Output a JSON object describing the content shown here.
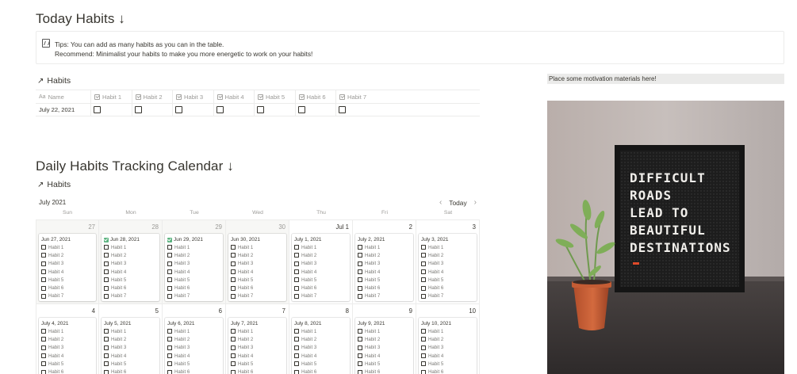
{
  "today": {
    "title": "Today Habits ↓",
    "callout": {
      "line1": "Tips: You can add as many habits as you can in the table.",
      "line2": "Recommend: Minimalist your habits to make you more energetic to work on your habits!"
    },
    "db_title": "Habits",
    "columns": [
      "Name",
      "Habit 1",
      "Habit 2",
      "Habit 3",
      "Habit 4",
      "Habit 5",
      "Habit 6",
      "Habit 7"
    ],
    "row": {
      "name": "July 22, 2021",
      "checks": [
        false,
        false,
        false,
        false,
        false,
        false,
        false
      ]
    }
  },
  "motivation": {
    "label": "Place some motivation materials here!",
    "board_lines": [
      "DIFFICULT",
      "ROADS",
      "LEAD TO",
      "BEAUTIFUL",
      "DESTINATIONS"
    ]
  },
  "calendar": {
    "title": "Daily Habits Tracking Calendar ↓",
    "db_title": "Habits",
    "month": "July 2021",
    "today_label": "Today",
    "weekdays": [
      "Sun",
      "Mon",
      "Tue",
      "Wed",
      "Thu",
      "Fri",
      "Sat"
    ],
    "habit_labels": [
      "Habit 1",
      "Habit 2",
      "Habit 3",
      "Habit 4",
      "Habit 5",
      "Habit 6",
      "Habit 7"
    ],
    "weeks": [
      [
        {
          "num": "27",
          "title": "Jun 27, 2021",
          "done": false,
          "dim": true
        },
        {
          "num": "28",
          "title": "Jun 28, 2021",
          "done": true,
          "dim": true
        },
        {
          "num": "29",
          "title": "Jun 29, 2021",
          "done": true,
          "dim": true
        },
        {
          "num": "30",
          "title": "Jun 30, 2021",
          "done": false,
          "dim": true
        },
        {
          "num": "Jul 1",
          "title": "July 1, 2021",
          "done": false,
          "dim": false
        },
        {
          "num": "2",
          "title": "July 2, 2021",
          "done": false,
          "dim": false
        },
        {
          "num": "3",
          "title": "July 3, 2021",
          "done": false,
          "dim": false
        }
      ],
      [
        {
          "num": "4",
          "title": "July 4, 2021",
          "done": false,
          "dim": false
        },
        {
          "num": "5",
          "title": "July 5, 2021",
          "done": false,
          "dim": false
        },
        {
          "num": "6",
          "title": "July 6, 2021",
          "done": false,
          "dim": false
        },
        {
          "num": "7",
          "title": "July 7, 2021",
          "done": false,
          "dim": false
        },
        {
          "num": "8",
          "title": "July 8, 2021",
          "done": false,
          "dim": false
        },
        {
          "num": "9",
          "title": "July 9, 2021",
          "done": false,
          "dim": false
        },
        {
          "num": "10",
          "title": "July 10, 2021",
          "done": false,
          "dim": false
        }
      ]
    ]
  }
}
